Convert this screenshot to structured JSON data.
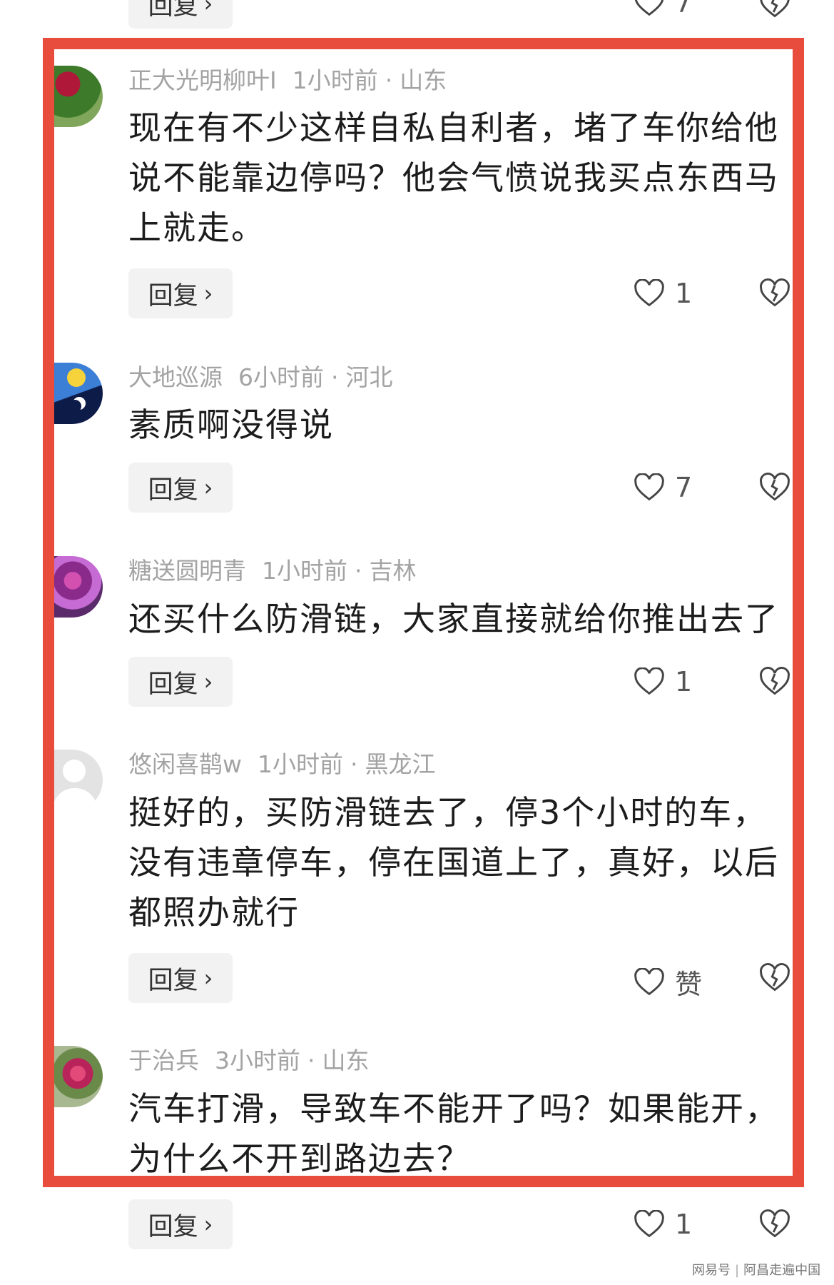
{
  "colors": {
    "highlight_border": "#e84c3d",
    "meta_text": "#a3a3a3",
    "reply_bg": "#f2f2f2"
  },
  "top_row": {
    "reply_label": "回复",
    "like_count": "7"
  },
  "comments": [
    {
      "user": "正大光明柳叶Ⅰ",
      "time": "1小时前",
      "location": "山东",
      "text": "现在有不少这样自私自利者，堵了车你给他说不能靠边停吗？他会气愤说我买点东西马上就走。",
      "reply_label": "回复",
      "like_count": "1",
      "avatar": "flower-avatar"
    },
    {
      "user": "大地巡源",
      "time": "6小时前",
      "location": "河北",
      "text": "素质啊没得说",
      "reply_label": "回复",
      "like_count": "7",
      "avatar": "sun-moon-avatar"
    },
    {
      "user": "糖送圆明青",
      "time": "1小时前",
      "location": "吉林",
      "text": "还买什么防滑链，大家直接就给你推出去了",
      "reply_label": "回复",
      "like_count": "1",
      "avatar": "purple-flower-avatar"
    },
    {
      "user": "悠闲喜鹊w",
      "time": "1小时前",
      "location": "黑龙江",
      "text": "挺好的，买防滑链去了，停3个小时的车，没有违章停车，停在国道上了，真好，以后都照办就行",
      "reply_label": "回复",
      "like_count": "赞",
      "avatar": "default-user-avatar"
    },
    {
      "user": "于治兵",
      "time": "3小时前",
      "location": "山东",
      "text": "汽车打滑，导致车不能开了吗？如果能开，为什么不开到路边去？",
      "reply_label": "回复",
      "like_count": "1",
      "avatar": "pink-flower-avatar"
    }
  ],
  "watermark": {
    "brand": "网易号",
    "account": "阿昌走遍中国"
  }
}
